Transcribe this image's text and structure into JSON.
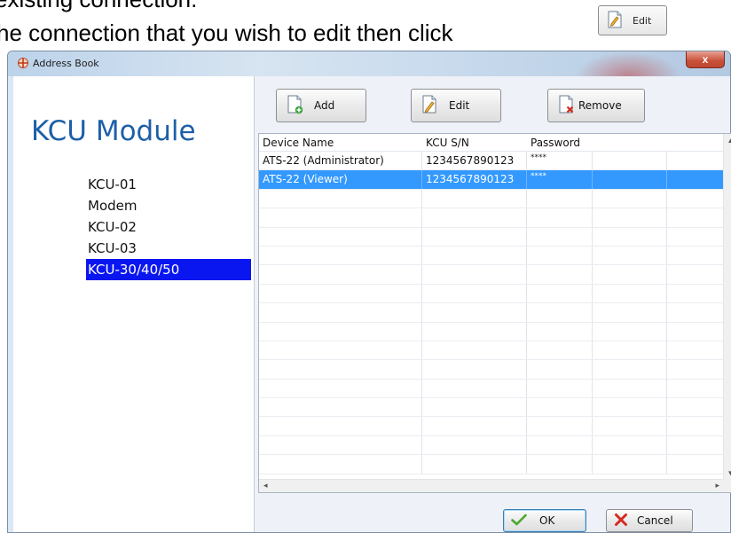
{
  "document": {
    "line1": "existing connection.",
    "line2": "he connection that you wish to edit then click",
    "inline_button_label": "Edit"
  },
  "window": {
    "title": "Address Book",
    "close_glyph": "x"
  },
  "left_panel": {
    "title": "KCU Module",
    "items": [
      {
        "label": "KCU-01",
        "selected": false
      },
      {
        "label": "Modem",
        "selected": false
      },
      {
        "label": "KCU-02",
        "selected": false
      },
      {
        "label": "KCU-03",
        "selected": false
      },
      {
        "label": "KCU-30/40/50",
        "selected": true
      }
    ]
  },
  "toolbar": {
    "add_label": "Add",
    "edit_label": "Edit",
    "remove_label": "Remove"
  },
  "grid": {
    "columns": [
      "Device Name",
      "KCU S/N",
      "Password",
      "",
      ""
    ],
    "rows": [
      {
        "device_name": "ATS-22 (Administrator)",
        "serial": "1234567890123",
        "password": "****",
        "selected": false
      },
      {
        "device_name": "ATS-22 (Viewer)",
        "serial": "1234567890123",
        "password": "****",
        "selected": true
      }
    ],
    "empty_row_count": 15
  },
  "buttons": {
    "ok_label": "OK",
    "cancel_label": "Cancel"
  },
  "colors": {
    "module_title": "#1d5fa7",
    "left_selection": "#0a16f0",
    "grid_selection": "#3399ff"
  },
  "icons": {
    "title": "address-book-icon",
    "add": "document-add-icon",
    "edit": "document-edit-icon",
    "remove": "document-remove-icon",
    "ok": "checkmark-icon",
    "cancel": "red-x-icon"
  }
}
